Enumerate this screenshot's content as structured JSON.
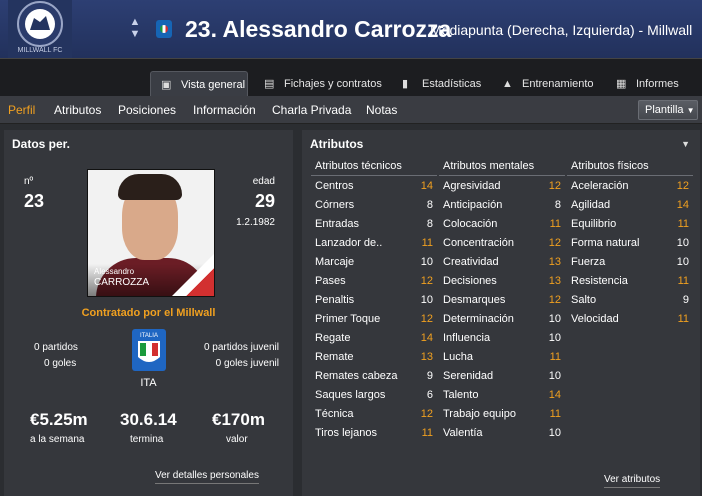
{
  "header": {
    "club_badge_text": "MILLWALL FC",
    "title": "23. Alessandro Carrozza",
    "subtitle": "Mediapunta (Derecha, Izquierda) - Millwall"
  },
  "tabs": [
    {
      "label": "Vista general",
      "icon": "person-card-icon"
    },
    {
      "label": "Fichajes y contratos",
      "icon": "document-icon"
    },
    {
      "label": "Estadísticas",
      "icon": "bar-chart-icon"
    },
    {
      "label": "Entrenamiento",
      "icon": "training-icon"
    },
    {
      "label": "Informes",
      "icon": "report-icon"
    }
  ],
  "subnav": {
    "items": [
      "Perfil",
      "Atributos",
      "Posiciones",
      "Información",
      "Charla Privada",
      "Notas"
    ],
    "dropdown": "Plantilla"
  },
  "left": {
    "title": "Datos per.",
    "number_label": "nº",
    "number": "23",
    "age_label": "edad",
    "age": "29",
    "birth_date": "1.2.1982",
    "photo_first": "Alessandro",
    "photo_last": "CARROZZA",
    "contract": "Contratado por el Millwall",
    "apps": "0 partidos",
    "goals": "0 goles",
    "youth_apps": "0 partidos juvenil",
    "youth_goals": "0 goles juvenil",
    "nation_badge_text": "ITALIA",
    "nation_code": "ITA",
    "wage": "€5.25m",
    "wage_label": "a la semana",
    "expires": "30.6.14",
    "expires_label": "termina",
    "value": "€170m",
    "value_label": "valor",
    "details_button": "Ver detalles personales"
  },
  "right": {
    "title": "Atributos",
    "columns": [
      {
        "header": "Atributos técnicos",
        "rows": [
          {
            "name": "Centros",
            "value": "14",
            "color": "orange"
          },
          {
            "name": "Córners",
            "value": "8",
            "color": "white"
          },
          {
            "name": "Entradas",
            "value": "8",
            "color": "white"
          },
          {
            "name": "Lanzador de..",
            "value": "11",
            "color": "orange"
          },
          {
            "name": "Marcaje",
            "value": "10",
            "color": "white"
          },
          {
            "name": "Pases",
            "value": "12",
            "color": "orange"
          },
          {
            "name": "Penaltis",
            "value": "10",
            "color": "white"
          },
          {
            "name": "Primer Toque",
            "value": "12",
            "color": "orange"
          },
          {
            "name": "Regate",
            "value": "14",
            "color": "orange"
          },
          {
            "name": "Remate",
            "value": "13",
            "color": "orange"
          },
          {
            "name": "Remates cabeza",
            "value": "9",
            "color": "white"
          },
          {
            "name": "Saques largos",
            "value": "6",
            "color": "white"
          },
          {
            "name": "Técnica",
            "value": "12",
            "color": "orange"
          },
          {
            "name": "Tiros lejanos",
            "value": "11",
            "color": "orange"
          }
        ]
      },
      {
        "header": "Atributos mentales",
        "rows": [
          {
            "name": "Agresividad",
            "value": "12",
            "color": "orange"
          },
          {
            "name": "Anticipación",
            "value": "8",
            "color": "white"
          },
          {
            "name": "Colocación",
            "value": "11",
            "color": "orange"
          },
          {
            "name": "Concentración",
            "value": "12",
            "color": "orange"
          },
          {
            "name": "Creatividad",
            "value": "13",
            "color": "orange"
          },
          {
            "name": "Decisiones",
            "value": "13",
            "color": "orange"
          },
          {
            "name": "Desmarques",
            "value": "12",
            "color": "orange"
          },
          {
            "name": "Determinación",
            "value": "10",
            "color": "white"
          },
          {
            "name": "Influencia",
            "value": "10",
            "color": "white"
          },
          {
            "name": "Lucha",
            "value": "11",
            "color": "orange"
          },
          {
            "name": "Serenidad",
            "value": "10",
            "color": "white"
          },
          {
            "name": "Talento",
            "value": "14",
            "color": "orange"
          },
          {
            "name": "Trabajo equipo",
            "value": "11",
            "color": "orange"
          },
          {
            "name": "Valentía",
            "value": "10",
            "color": "white"
          }
        ]
      },
      {
        "header": "Atributos físicos",
        "rows": [
          {
            "name": "Aceleración",
            "value": "12",
            "color": "orange"
          },
          {
            "name": "Agilidad",
            "value": "14",
            "color": "orange"
          },
          {
            "name": "Equilibrio",
            "value": "11",
            "color": "orange"
          },
          {
            "name": "Forma natural",
            "value": "10",
            "color": "white"
          },
          {
            "name": "Fuerza",
            "value": "10",
            "color": "white"
          },
          {
            "name": "Resistencia",
            "value": "11",
            "color": "orange"
          },
          {
            "name": "Salto",
            "value": "9",
            "color": "white"
          },
          {
            "name": "Velocidad",
            "value": "11",
            "color": "orange"
          }
        ]
      }
    ],
    "more_button": "Ver atributos"
  }
}
